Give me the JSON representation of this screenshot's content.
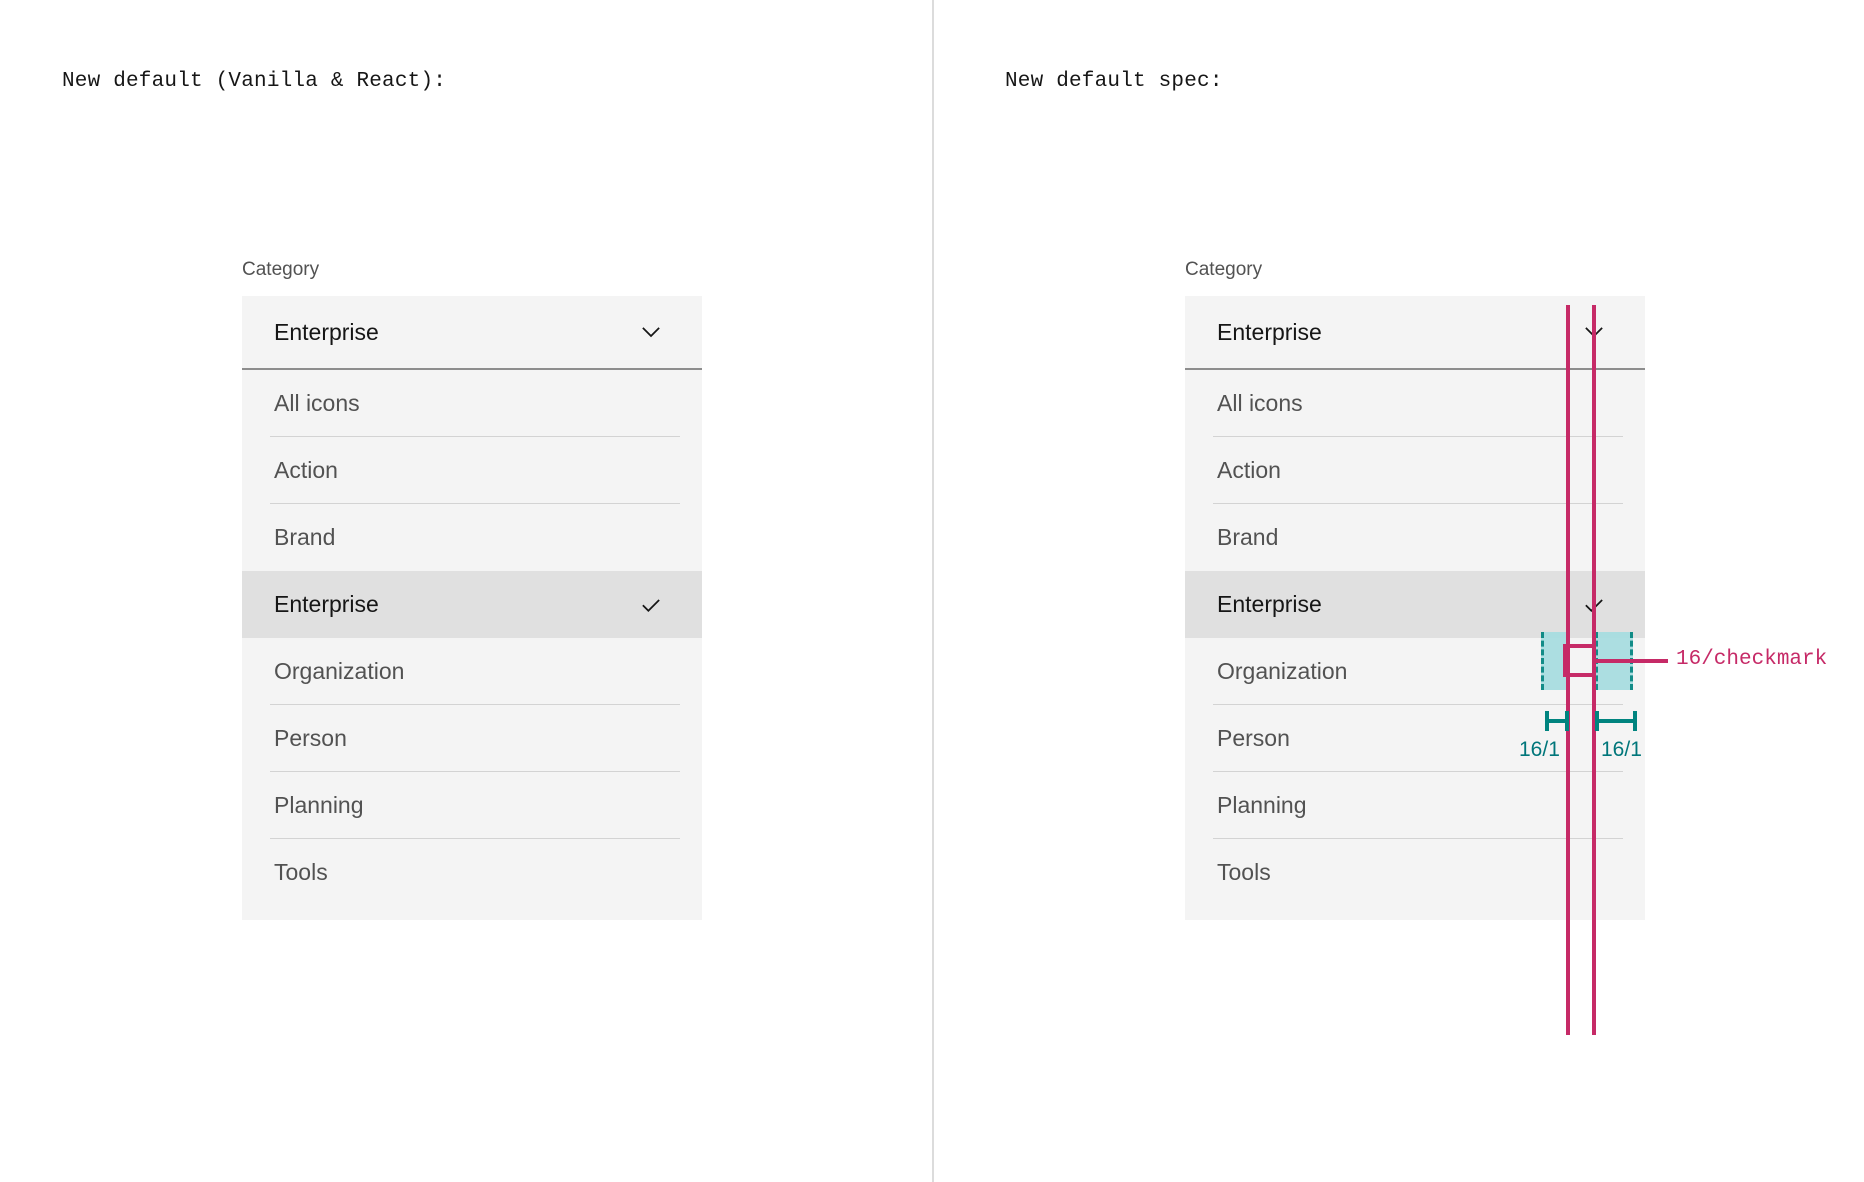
{
  "panels": {
    "left": {
      "caption": "New default (Vanilla & React):"
    },
    "right": {
      "caption": "New default spec:"
    }
  },
  "dropdown": {
    "label": "Category",
    "selected_value": "Enterprise",
    "chevron_icon": "chevron-down-icon",
    "check_icon": "checkmark-icon",
    "items": [
      {
        "label": "All icons",
        "selected": false
      },
      {
        "label": "Action",
        "selected": false
      },
      {
        "label": "Brand",
        "selected": false
      },
      {
        "label": "Enterprise",
        "selected": true
      },
      {
        "label": "Organization",
        "selected": false
      },
      {
        "label": "Person",
        "selected": false
      },
      {
        "label": "Planning",
        "selected": false
      },
      {
        "label": "Tools",
        "selected": false
      }
    ]
  },
  "spec": {
    "checkmark_callout": "16/checkmark",
    "measure_left": "16/1",
    "measure_right": "16/1",
    "colors": {
      "annotation_red": "#c62a67",
      "annotation_teal": "#00847f",
      "highlight_fill": "#a6dde0",
      "field_bg": "#f4f4f4",
      "selected_bg": "#e0e0e0",
      "field_underline": "#8d8d8d",
      "divider": "#d3d3d3",
      "text_primary": "#161616",
      "text_secondary": "#525252",
      "panel_divider": "#dcdcdc"
    }
  }
}
